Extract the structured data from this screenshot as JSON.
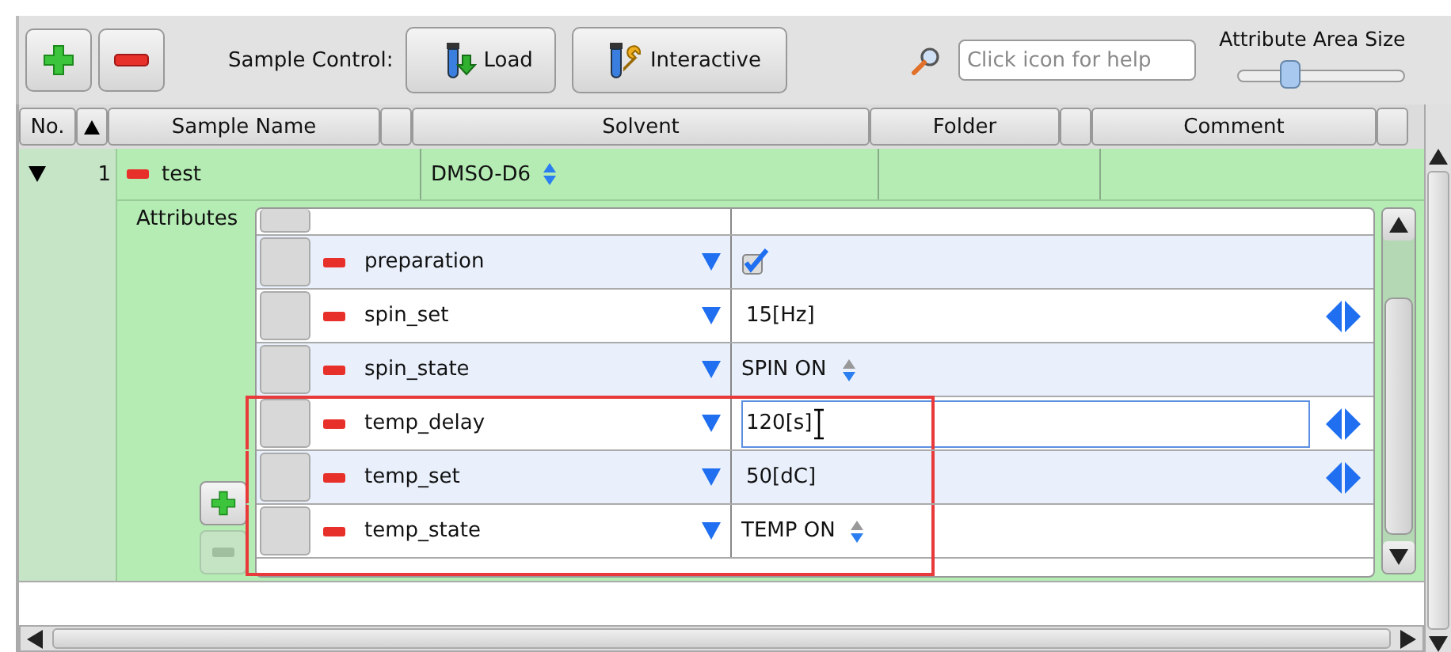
{
  "toolbar": {
    "label": "Sample Control:",
    "buttons": [
      {
        "label": "Load",
        "kind": "load"
      },
      {
        "label": "Interactive",
        "kind": "interactive"
      }
    ],
    "help": {
      "placeholder": "Click icon for help"
    },
    "slider": {
      "label": "Attribute Area Size",
      "level": 0.3
    }
  },
  "table": {
    "columns": [
      "No.",
      "Sample Name",
      "Solvent",
      "Folder",
      "Comment"
    ],
    "rows": [
      {
        "expanded": true,
        "no": "1",
        "name": "test",
        "solvent": "DMSO-D6",
        "attributes_label": "Attributes",
        "remove_attribute_disabled": true,
        "attributes": [
          {
            "name": "preparation",
            "kind": "checkbox",
            "checked": true,
            "highlighted": false
          },
          {
            "name": "spin_set",
            "kind": "quantity",
            "value": "15[Hz]",
            "highlighted": false,
            "editing": false
          },
          {
            "name": "spin_state",
            "kind": "choice",
            "value": "SPIN ON",
            "highlighted": false
          },
          {
            "name": "temp_delay",
            "kind": "quantity",
            "value": "120[s]",
            "highlighted": true,
            "editing": true
          },
          {
            "name": "temp_set",
            "kind": "quantity",
            "value": "50[dC]",
            "highlighted": true,
            "editing": false
          },
          {
            "name": "temp_state",
            "kind": "choice",
            "value": "TEMP ON",
            "highlighted": true
          }
        ]
      }
    ]
  }
}
